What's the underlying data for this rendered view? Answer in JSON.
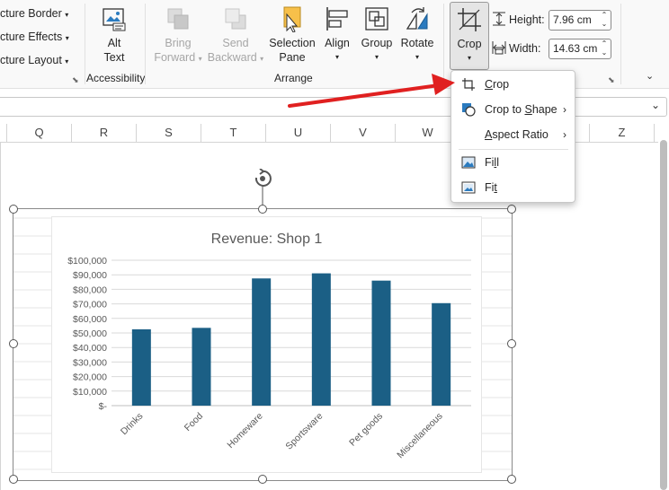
{
  "ribbon": {
    "picture_styles": {
      "border": "cture Border",
      "effects": "cture Effects",
      "layout": "cture Layout"
    },
    "accessibility": {
      "alt_text_line1": "Alt",
      "alt_text_line2": "Text",
      "group_label": "Accessibility"
    },
    "arrange": {
      "bring_forward_line1": "Bring",
      "bring_forward_line2": "Forward",
      "send_backward_line1": "Send",
      "send_backward_line2": "Backward",
      "selection_pane_line1": "Selection",
      "selection_pane_line2": "Pane",
      "align": "Align",
      "group": "Group",
      "rotate": "Rotate",
      "group_label": "Arrange"
    },
    "size": {
      "crop": "Crop",
      "height_label": "Height:",
      "height_value": "7.96 cm",
      "width_label": "Width:",
      "width_value": "14.63 cm"
    }
  },
  "columns": [
    "Q",
    "R",
    "S",
    "T",
    "U",
    "V",
    "W",
    "Z"
  ],
  "crop_menu": {
    "items": [
      {
        "label": "Crop",
        "icon": "crop-icon"
      },
      {
        "label": "Crop to Shape",
        "icon": "crop-to-shape-icon",
        "submenu": true
      },
      {
        "label": "Aspect Ratio",
        "submenu": true
      },
      {
        "label": "Fill",
        "icon": "fill-icon"
      },
      {
        "label": "Fit",
        "icon": "fit-icon"
      }
    ]
  },
  "annotation": {
    "color": "#e02020"
  },
  "chart_data": {
    "type": "bar",
    "title": "Revenue: Shop 1",
    "categories": [
      "Drinks",
      "Food",
      "Homeware",
      "Sportsware",
      "Pet goods",
      "Miscellaneous"
    ],
    "values": [
      52500,
      53500,
      87500,
      91000,
      86000,
      70500
    ],
    "ylim": [
      0,
      100000
    ],
    "yticks": [
      "$-",
      "$10,000",
      "$20,000",
      "$30,000",
      "$40,000",
      "$50,000",
      "$60,000",
      "$70,000",
      "$80,000",
      "$90,000",
      "$100,000"
    ],
    "xlabel": "",
    "ylabel": "",
    "bar_color": "#1b5f85",
    "grid": true
  }
}
